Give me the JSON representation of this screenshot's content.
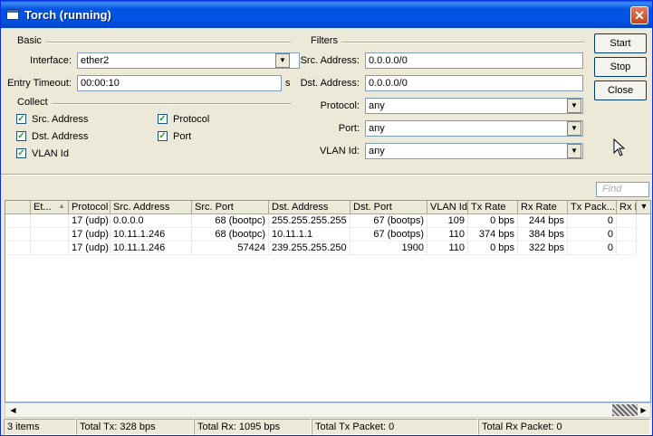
{
  "window": {
    "title": "Torch (running)",
    "close": "✕"
  },
  "basic": {
    "label": "Basic",
    "interface_label": "Interface:",
    "interface_value": "ether2",
    "timeout_label": "Entry Timeout:",
    "timeout_value": "00:00:10",
    "timeout_unit": "s"
  },
  "collect": {
    "label": "Collect",
    "items": [
      {
        "label": "Src. Address",
        "checked": true
      },
      {
        "label": "Protocol",
        "checked": true
      },
      {
        "label": "Dst. Address",
        "checked": true
      },
      {
        "label": "Port",
        "checked": true
      },
      {
        "label": "VLAN Id",
        "checked": true
      }
    ]
  },
  "filters": {
    "label": "Filters",
    "src_label": "Src. Address:",
    "src_value": "0.0.0.0/0",
    "dst_label": "Dst. Address:",
    "dst_value": "0.0.0.0/0",
    "protocol_label": "Protocol:",
    "protocol_value": "any",
    "port_label": "Port:",
    "port_value": "any",
    "vlan_label": "VLAN Id:",
    "vlan_value": "any"
  },
  "buttons": {
    "start": "Start",
    "stop": "Stop",
    "close": "Close"
  },
  "find_placeholder": "Find",
  "table": {
    "columns": [
      "Et...",
      "Protocol",
      "Src. Address",
      "Src. Port",
      "Dst. Address",
      "Dst. Port",
      "VLAN Id",
      "Tx Rate",
      "Rx Rate",
      "Tx Pack...",
      "Rx I"
    ],
    "rows": [
      [
        "",
        "17 (udp)",
        "0.0.0.0",
        "68 (bootpc)",
        "255.255.255.255",
        "67 (bootps)",
        "109",
        "0 bps",
        "244 bps",
        "0",
        ""
      ],
      [
        "",
        "17 (udp)",
        "10.11.1.246",
        "68 (bootpc)",
        "10.11.1.1",
        "67 (bootps)",
        "110",
        "374 bps",
        "384 bps",
        "0",
        ""
      ],
      [
        "",
        "17 (udp)",
        "10.11.1.246",
        "57424",
        "239.255.255.250",
        "1900",
        "110",
        "0 bps",
        "322 bps",
        "0",
        ""
      ]
    ]
  },
  "status": {
    "items": "3 items",
    "total_tx": "Total Tx: 328 bps",
    "total_rx": "Total Rx: 1095 bps",
    "total_tx_packet": "Total Tx Packet: 0",
    "total_rx_packet": "Total Rx Packet: 0"
  },
  "icons": {
    "dropdown": "dropdown-arrow-icon",
    "close": "close-icon",
    "window": "window-icon",
    "check": "checkmark-icon",
    "sort": "sort-ascending-icon"
  },
  "colors": {
    "titlebar": "#0054e3",
    "close": "#c6421f",
    "check": "#21a121"
  }
}
